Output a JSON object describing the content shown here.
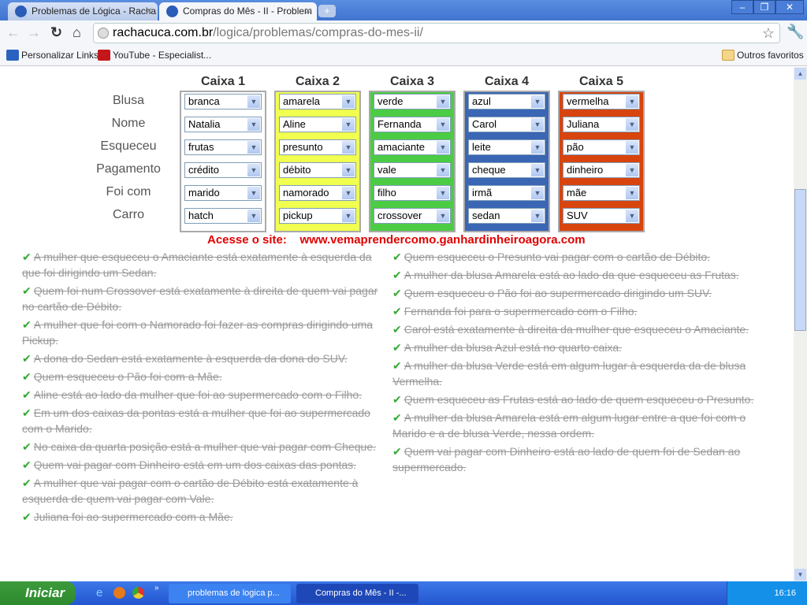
{
  "browser": {
    "tabs": [
      {
        "label": "Problemas de Lógica - Racha C"
      },
      {
        "label": "Compras do Mês - II - Problem"
      }
    ],
    "url_domain": "rachacuca.com.br",
    "url_path": "/logica/problemas/compras-do-mes-ii/",
    "bookmarks": [
      {
        "label": "Personalizar Links"
      },
      {
        "label": "YouTube - Especialist..."
      }
    ],
    "other_bookmarks": "Outros favoritos"
  },
  "puzzle": {
    "row_labels": [
      "Blusa",
      "Nome",
      "Esqueceu",
      "Pagamento",
      "Foi com",
      "Carro"
    ],
    "boxes": [
      {
        "title": "Caixa 1",
        "color": "#ffffff",
        "border": "#aaaaaa",
        "values": [
          "branca",
          "Natalia",
          "frutas",
          "crédito",
          "marido",
          "hatch"
        ]
      },
      {
        "title": "Caixa 2",
        "color": "#f0ff50",
        "border": "#aaaaaa",
        "values": [
          "amarela",
          "Aline",
          "presunto",
          "débito",
          "namorado",
          "pickup"
        ]
      },
      {
        "title": "Caixa 3",
        "color": "#4ccc44",
        "border": "#aaaaaa",
        "values": [
          "verde",
          "Fernanda",
          "amaciante",
          "vale",
          "filho",
          "crossover"
        ]
      },
      {
        "title": "Caixa 4",
        "color": "#3a66b4",
        "border": "#aaaaaa",
        "values": [
          "azul",
          "Carol",
          "leite",
          "cheque",
          "irmã",
          "sedan"
        ]
      },
      {
        "title": "Caixa 5",
        "color": "#d8440e",
        "border": "#aaaaaa",
        "values": [
          "vermelha",
          "Juliana",
          "pão",
          "dinheiro",
          "mãe",
          "SUV"
        ]
      }
    ],
    "ad_text": "Acesse o site:    www.vemaprendercomo.ganhardinheiroagora.com"
  },
  "clues_left": [
    "A mulher que esqueceu o Amaciante está exatamente à esquerda da que foi dirigindo um Sedan.",
    "Quem foi num Crossover está exatamente à direita de quem vai pagar no cartão de Débito.",
    "A mulher que foi com o Namorado foi fazer as compras dirigindo uma Pickup.",
    "A dona do Sedan está exatamente à esquerda da dona do SUV.",
    "Quem esqueceu o Pão foi com a Mãe.",
    "Aline está ao lado da mulher que foi ao supermercado com o Filho.",
    "Em um dos caixas da pontas está a mulher que foi ao supermercado com o Marido.",
    "No caixa da quarta posição está a mulher que vai pagar com Cheque.",
    "Quem vai pagar com Dinheiro está em um dos caixas das pontas.",
    "A mulher que vai pagar com o cartão de Débito está exatamente à esquerda de quem vai pagar com Vale.",
    "Juliana foi ao supermercado com a Mãe."
  ],
  "clues_right": [
    "Quem esqueceu o Presunto vai pagar com o cartão de Débito.",
    "A mulher da blusa Amarela está ao lado da que esqueceu as Frutas.",
    "Quem esqueceu o Pão foi ao supermercado dirigindo um SUV.",
    "Fernanda foi para o supermercado com o Filho.",
    "Carol está exatamente à direita da mulher que esqueceu o Amaciante.",
    "A mulher da blusa Azul está no quarto caixa.",
    "A mulher da blusa Verde está em algum lugar à esquerda da de blusa Vermelha.",
    "Quem esqueceu as Frutas está ao lado de quem esqueceu o Presunto.",
    "A mulher da blusa Amarela está em algum lugar entre a que foi com o Marido e a de blusa Verde, nessa ordem.",
    "Quem vai pagar com Dinheiro está ao lado de quem foi de Sedan ao supermercado."
  ],
  "taskbar": {
    "start": "Iniciar",
    "tasks": [
      {
        "label": "problemas de logica p..."
      },
      {
        "label": "Compras do Mês - II -..."
      }
    ],
    "clock": "16:16"
  }
}
